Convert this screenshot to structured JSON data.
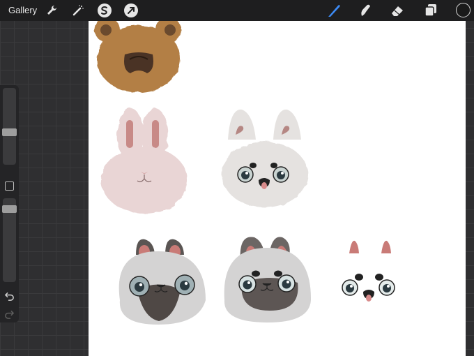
{
  "toolbar": {
    "gallery_label": "Gallery",
    "left_tools": [
      "wrench-icon",
      "magic-wand-icon",
      "selection-s-icon",
      "transform-arrow-icon"
    ],
    "right_tools": [
      "brush-icon",
      "smudge-icon",
      "eraser-icon",
      "layers-icon"
    ],
    "active_tool": "brush-icon",
    "accent_color": "#3d8bf5",
    "current_color": "#1a1a1a"
  },
  "sidebar": {
    "brush_size_level": 0.45,
    "opacity_level": 0.15,
    "controls": [
      "brush-size-slider",
      "modify-button",
      "opacity-slider",
      "undo-icon",
      "redo-icon"
    ]
  },
  "canvas": {
    "background": "#ffffff",
    "drawings": [
      "brown-bear-face",
      "pink-bunny-face",
      "white-cat-face",
      "siamese-cat-face-1",
      "siamese-cat-face-2",
      "line-art-cat-face"
    ]
  }
}
